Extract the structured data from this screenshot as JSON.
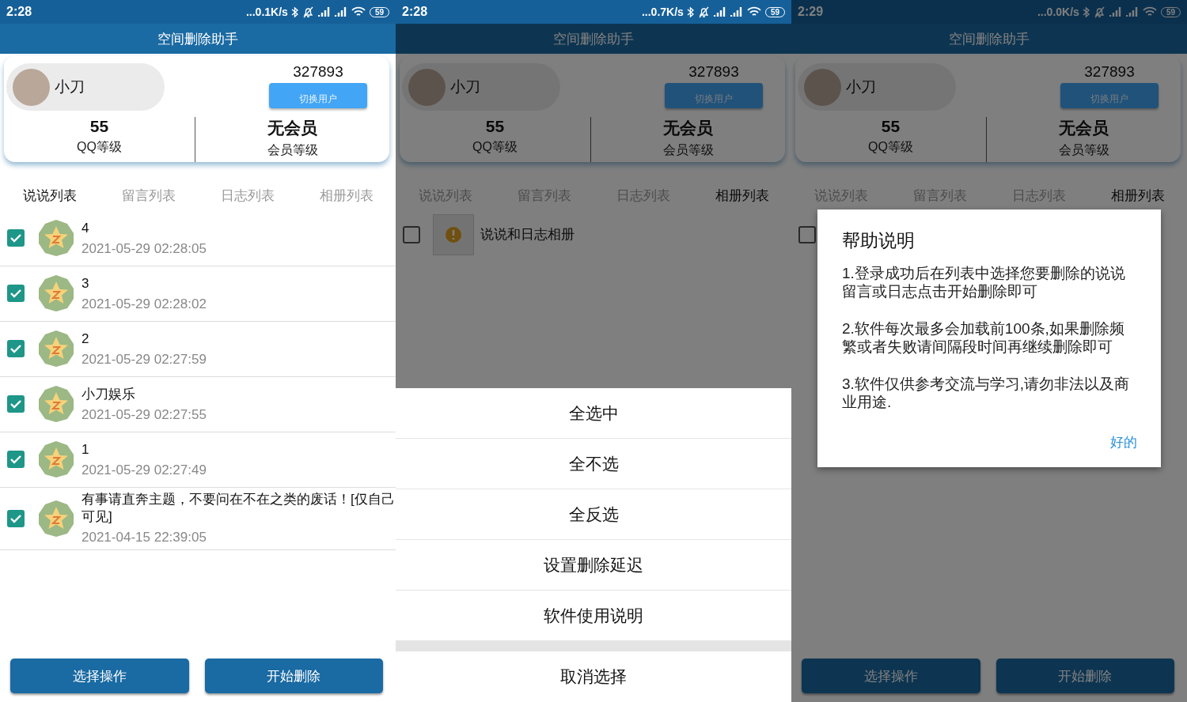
{
  "panels": [
    {
      "status_bar": {
        "time": "2:28",
        "speed": "...0.1K/s",
        "battery": "59"
      },
      "title": "空间删除助手",
      "profile": {
        "name": "小刀",
        "qq": "327893",
        "switch_button": "切换用户",
        "level_value": "55",
        "level_label": "QQ等级",
        "member_value": "无会员",
        "member_label": "会员等级"
      },
      "tabs": [
        {
          "label": "说说列表",
          "selected": true
        },
        {
          "label": "留言列表",
          "selected": false
        },
        {
          "label": "日志列表",
          "selected": false
        },
        {
          "label": "相册列表",
          "selected": false
        }
      ],
      "rows": [
        {
          "kind": "post",
          "checked": true,
          "title": "4",
          "time": "2021-05-29 02:28:05"
        },
        {
          "kind": "post",
          "checked": true,
          "title": "3",
          "time": "2021-05-29 02:28:02"
        },
        {
          "kind": "post",
          "checked": true,
          "title": "2",
          "time": "2021-05-29 02:27:59"
        },
        {
          "kind": "post",
          "checked": true,
          "title": "小刀娱乐",
          "time": "2021-05-29 02:27:55"
        },
        {
          "kind": "post",
          "checked": true,
          "title": "1",
          "time": "2021-05-29 02:27:49"
        },
        {
          "kind": "post",
          "checked": true,
          "title": "有事请直奔主题，不要问在不在之类的废话！[仅自己可见]",
          "time": "2021-04-15 22:39:05"
        }
      ],
      "buttons": [
        "选择操作",
        "开始删除"
      ]
    },
    {
      "status_bar": {
        "time": "2:28",
        "speed": "...0.7K/s",
        "battery": "59"
      },
      "title": "空间删除助手",
      "profile": {
        "name": "小刀",
        "qq": "327893",
        "switch_button": "切换用户",
        "level_value": "55",
        "level_label": "QQ等级",
        "member_value": "无会员",
        "member_label": "会员等级"
      },
      "tabs": [
        {
          "label": "说说列表",
          "selected": false
        },
        {
          "label": "留言列表",
          "selected": false
        },
        {
          "label": "日志列表",
          "selected": false
        },
        {
          "label": "相册列表",
          "selected": true
        }
      ],
      "rows": [
        {
          "kind": "album",
          "checked": false,
          "title": "说说和日志相册"
        }
      ],
      "overlay": {
        "kind": "sheet",
        "items": [
          "全选中",
          "全不选",
          "全反选",
          "设置删除延迟",
          "软件使用说明"
        ],
        "cancel": "取消选择"
      }
    },
    {
      "status_bar": {
        "time": "2:29",
        "speed": "...0.0K/s",
        "battery": "59"
      },
      "title": "空间删除助手",
      "profile": {
        "name": "小刀",
        "qq": "327893",
        "switch_button": "切换用户",
        "level_value": "55",
        "level_label": "QQ等级",
        "member_value": "无会员",
        "member_label": "会员等级"
      },
      "tabs": [
        {
          "label": "说说列表",
          "selected": false
        },
        {
          "label": "留言列表",
          "selected": false
        },
        {
          "label": "日志列表",
          "selected": false
        },
        {
          "label": "相册列表",
          "selected": true
        }
      ],
      "rows": [
        {
          "kind": "album",
          "checked": false
        }
      ],
      "buttons": [
        "选择操作",
        "开始删除"
      ],
      "overlay": {
        "kind": "dialog",
        "title": "帮助说明",
        "paragraphs": [
          "1.登录成功后在列表中选择您要删除的说说留言或日志点击开始删除即可",
          "2.软件每次最多会加载前100条,如果删除频繁或者失败请间隔段时间再继续删除即可",
          "3.软件仅供参考交流与学习,请勿非法以及商业用途."
        ],
        "ok": "好的"
      }
    }
  ]
}
